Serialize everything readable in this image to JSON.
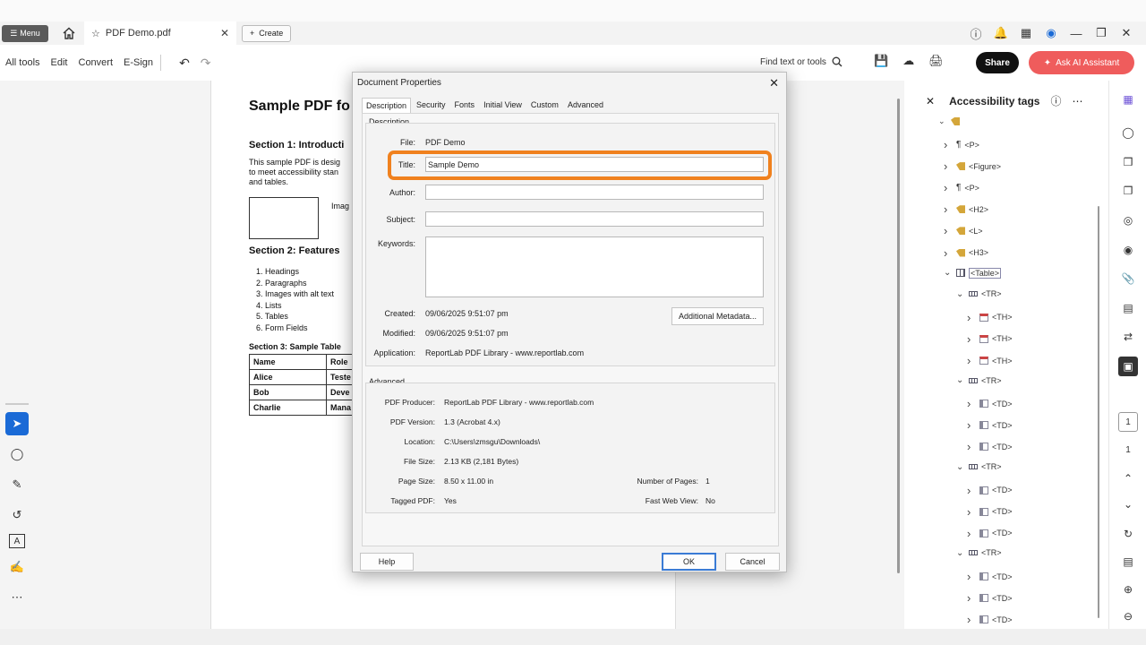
{
  "tabbar": {
    "menu_label": "Menu",
    "doc_tab_label": "PDF Demo.pdf",
    "create_label": "Create"
  },
  "toolbar": {
    "items": [
      "All tools",
      "Edit",
      "Convert",
      "E-Sign"
    ],
    "find_label": "Find text or tools",
    "share_label": "Share",
    "ai_label": "Ask AI Assistant"
  },
  "pdf": {
    "title": "Sample PDF fo",
    "section1": "Section 1: Introducti",
    "para1": "This sample PDF is desig",
    "para2": "to meet accessibility stan",
    "para3": "and tables.",
    "image_label": "Imag",
    "section2": "Section 2: Features",
    "list": [
      "1. Headings",
      "2. Paragraphs",
      "3. Images with alt text",
      "4. Lists",
      "5. Tables",
      "6. Form Fields"
    ],
    "section3": "Section 3: Sample Table",
    "table": [
      [
        "Name",
        "Role"
      ],
      [
        "Alice",
        "Teste"
      ],
      [
        "Bob",
        "Deve"
      ],
      [
        "Charlie",
        "Mana"
      ]
    ]
  },
  "dialog": {
    "title": "Document Properties",
    "tabs": [
      "Description",
      "Security",
      "Fonts",
      "Initial View",
      "Custom",
      "Advanced"
    ],
    "description_group": "Description",
    "file_label": "File:",
    "file_value": "PDF Demo",
    "title_label": "Title:",
    "title_value": "Sample Demo",
    "author_label": "Author:",
    "author_value": "",
    "subject_label": "Subject:",
    "subject_value": "",
    "keywords_label": "Keywords:",
    "keywords_value": "",
    "created_label": "Created:",
    "created_value": "09/06/2025 9:51:07 pm",
    "modified_label": "Modified:",
    "modified_value": "09/06/2025 9:51:07 pm",
    "application_label": "Application:",
    "application_value": "ReportLab PDF Library - www.reportlab.com",
    "additional_metadata_label": "Additional Metadata...",
    "advanced_group": "Advanced",
    "producer_label": "PDF Producer:",
    "producer_value": "ReportLab PDF Library - www.reportlab.com",
    "version_label": "PDF Version:",
    "version_value": "1.3 (Acrobat 4.x)",
    "location_label": "Location:",
    "location_value": "C:\\Users\\zmsgu\\Downloads\\",
    "filesize_label": "File Size:",
    "filesize_value": "2.13 KB (2,181 Bytes)",
    "pagesize_label": "Page Size:",
    "pagesize_value": "8.50 x 11.00 in",
    "pages_label": "Number of Pages:",
    "pages_value": "1",
    "tagged_label": "Tagged PDF:",
    "tagged_value": "Yes",
    "fastweb_label": "Fast Web View:",
    "fastweb_value": "No",
    "help_label": "Help",
    "ok_label": "OK",
    "cancel_label": "Cancel"
  },
  "panel": {
    "title": "Accessibility tags",
    "tree": [
      {
        "label": "<P>",
        "icon": "paragraph-icon",
        "expanded": false
      },
      {
        "label": "<Figure>",
        "icon": "tag-icon",
        "expanded": false
      },
      {
        "label": "<P>",
        "icon": "paragraph-icon",
        "expanded": false
      },
      {
        "label": "<H2>",
        "icon": "tag-icon",
        "expanded": false
      },
      {
        "label": "<L>",
        "icon": "tag-icon",
        "expanded": false
      },
      {
        "label": "<H3>",
        "icon": "tag-icon",
        "expanded": false
      },
      {
        "label": "<Table>",
        "icon": "table-icon",
        "expanded": true
      },
      {
        "label": "<TR>",
        "icon": "row-icon",
        "expanded": true
      },
      {
        "label": "<TH>",
        "icon": "header-cell-icon",
        "expanded": false
      },
      {
        "label": "<TH>",
        "icon": "header-cell-icon",
        "expanded": false
      },
      {
        "label": "<TH>",
        "icon": "header-cell-icon",
        "expanded": false
      },
      {
        "label": "<TR>",
        "icon": "row-icon",
        "expanded": true
      },
      {
        "label": "<TD>",
        "icon": "cell-icon",
        "expanded": false
      },
      {
        "label": "<TD>",
        "icon": "cell-icon",
        "expanded": false
      },
      {
        "label": "<TD>",
        "icon": "cell-icon",
        "expanded": false
      },
      {
        "label": "<TR>",
        "icon": "row-icon",
        "expanded": true
      },
      {
        "label": "<TD>",
        "icon": "cell-icon",
        "expanded": false
      },
      {
        "label": "<TD>",
        "icon": "cell-icon",
        "expanded": false
      },
      {
        "label": "<TD>",
        "icon": "cell-icon",
        "expanded": false
      },
      {
        "label": "<TR>",
        "icon": "row-icon",
        "expanded": true
      },
      {
        "label": "<TD>",
        "icon": "cell-icon",
        "expanded": false
      },
      {
        "label": "<TD>",
        "icon": "cell-icon",
        "expanded": false
      },
      {
        "label": "<TD>",
        "icon": "cell-icon",
        "expanded": false
      }
    ]
  },
  "rightrail": {
    "page_number": "1",
    "page_total": "1"
  },
  "colors": {
    "accent_blue": "#1a6ad6",
    "highlight_orange": "#f0811e",
    "ai_button": "#ef5c5c",
    "tag_gold": "#d4a63a"
  }
}
